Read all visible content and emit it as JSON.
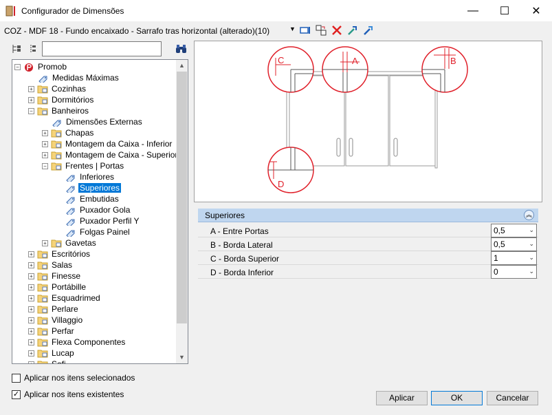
{
  "window": {
    "title": "Configurador de Dimensões",
    "minimize": "—",
    "maximize": "☐",
    "close": "✕"
  },
  "toolbar": {
    "item_name": "COZ - MDF 18 - Fundo encaixado - Sarrafo tras horizontal (alterado)(10)",
    "dropdown": "▼"
  },
  "search": {
    "value": ""
  },
  "tree": [
    {
      "label": "Promob",
      "level": 0,
      "expander": "−",
      "icon": "promob-logo-icon"
    },
    {
      "label": "Medidas Máximas",
      "level": 1,
      "icon": "tag-icon"
    },
    {
      "label": "Cozinhas",
      "level": 1,
      "expander": "+",
      "icon": "folder-icon"
    },
    {
      "label": "Dormitórios",
      "level": 1,
      "expander": "+",
      "icon": "folder-icon"
    },
    {
      "label": "Banheiros",
      "level": 1,
      "expander": "−",
      "icon": "folder-icon"
    },
    {
      "label": "Dimensões Externas",
      "level": 2,
      "icon": "tag-icon"
    },
    {
      "label": "Chapas",
      "level": 2,
      "expander": "+",
      "icon": "folder-icon"
    },
    {
      "label": "Montagem da Caixa - Inferior",
      "level": 2,
      "expander": "+",
      "icon": "folder-icon"
    },
    {
      "label": "Montagem de Caixa - Superior",
      "level": 2,
      "expander": "+",
      "icon": "folder-icon"
    },
    {
      "label": "Frentes | Portas",
      "level": 2,
      "expander": "−",
      "icon": "folder-icon"
    },
    {
      "label": "Inferiores",
      "level": 3,
      "icon": "tag-icon"
    },
    {
      "label": "Superiores",
      "level": 3,
      "icon": "tag-icon",
      "selected": true
    },
    {
      "label": "Embutidas",
      "level": 3,
      "icon": "tag-icon"
    },
    {
      "label": "Puxador Gola",
      "level": 3,
      "icon": "tag-icon"
    },
    {
      "label": "Puxador Perfil Y",
      "level": 3,
      "icon": "tag-icon"
    },
    {
      "label": "Folgas Painel",
      "level": 3,
      "icon": "tag-icon"
    },
    {
      "label": "Gavetas",
      "level": 2,
      "expander": "+",
      "icon": "folder-icon"
    },
    {
      "label": "Escritórios",
      "level": 1,
      "expander": "+",
      "icon": "folder-icon"
    },
    {
      "label": "Salas",
      "level": 1,
      "expander": "+",
      "icon": "folder-icon"
    },
    {
      "label": "Finesse",
      "level": 1,
      "expander": "+",
      "icon": "folder-icon"
    },
    {
      "label": "Portábille",
      "level": 1,
      "expander": "+",
      "icon": "folder-icon"
    },
    {
      "label": "Esquadrimed",
      "level": 1,
      "expander": "+",
      "icon": "folder-icon"
    },
    {
      "label": "Perlare",
      "level": 1,
      "expander": "+",
      "icon": "folder-icon"
    },
    {
      "label": "Villaggio",
      "level": 1,
      "expander": "+",
      "icon": "folder-icon"
    },
    {
      "label": "Perfar",
      "level": 1,
      "expander": "+",
      "icon": "folder-icon"
    },
    {
      "label": "Flexa Componentes",
      "level": 1,
      "expander": "+",
      "icon": "folder-icon"
    },
    {
      "label": "Lucap",
      "level": 1,
      "expander": "+",
      "icon": "folder-icon"
    },
    {
      "label": "Sofi",
      "level": 1,
      "expander": "+",
      "icon": "folder-icon"
    }
  ],
  "diagram": {
    "labels": {
      "a": "A",
      "b": "B",
      "c": "C",
      "d": "D"
    },
    "accent": "#e0202a"
  },
  "properties": {
    "header": "Superiores",
    "rows": [
      {
        "name": "A - Entre Portas",
        "value": "0,5"
      },
      {
        "name": "B - Borda Lateral",
        "value": "0,5"
      },
      {
        "name": "C - Borda Superior",
        "value": "1"
      },
      {
        "name": "D - Borda Inferior",
        "value": "0"
      }
    ]
  },
  "options": {
    "apply_selected": {
      "label": "Aplicar nos itens selecionados",
      "checked": false
    },
    "apply_existing": {
      "label": "Aplicar nos itens existentes",
      "checked": true
    }
  },
  "buttons": {
    "apply": "Aplicar",
    "ok": "OK",
    "cancel": "Cancelar"
  }
}
